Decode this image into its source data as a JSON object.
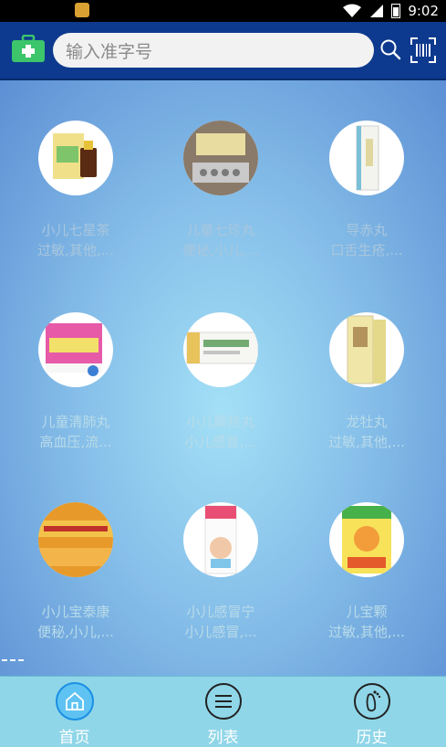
{
  "status_bar": {
    "time": "9:02"
  },
  "header": {
    "search_placeholder": "输入准字号",
    "icons": {
      "left": "medical-kit-icon",
      "search": "search-icon",
      "scan": "barcode-scan-icon"
    }
  },
  "medicines": [
    {
      "name": "小儿七星茶",
      "desc": "过敏,其他,..."
    },
    {
      "name": "儿童七珍丸",
      "desc": "便秘,小儿,..."
    },
    {
      "name": "导赤丸",
      "desc": "口舌生疮,..."
    },
    {
      "name": "儿童清肺丸",
      "desc": "高血压,流..."
    },
    {
      "name": "小儿解热丸",
      "desc": "小儿感冒,..."
    },
    {
      "name": "龙牡丸",
      "desc": "过敏,其他,..."
    },
    {
      "name": "小儿宝泰康",
      "desc": "便秘,小儿,..."
    },
    {
      "name": "小儿感冒宁",
      "desc": "小儿感冒,..."
    },
    {
      "name": "儿宝颗",
      "desc": "过敏,其他,..."
    }
  ],
  "bottom_nav": [
    {
      "label": "首页",
      "icon": "home-icon",
      "active": true
    },
    {
      "label": "列表",
      "icon": "list-icon",
      "active": false
    },
    {
      "label": "历史",
      "icon": "footprint-icon",
      "active": false
    }
  ],
  "colors": {
    "header_bg": "#0d3a8e",
    "nav_bg": "#8fd6e8",
    "active_tab": "#5ec3f2"
  }
}
